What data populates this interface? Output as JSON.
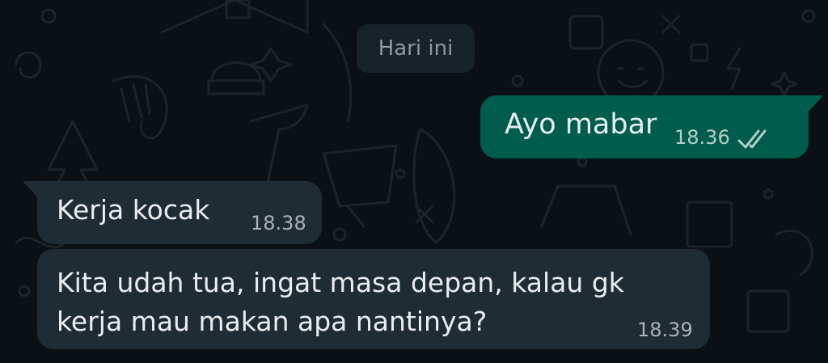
{
  "chat": {
    "date_separator": "Hari ini",
    "messages": [
      {
        "direction": "outgoing",
        "text": "Ayo mabar",
        "time": "18.36",
        "status": "read"
      },
      {
        "direction": "incoming",
        "text": "Kerja kocak",
        "time": "18.38"
      },
      {
        "direction": "incoming",
        "text": "Kita udah tua, ingat masa depan, kalau gk\nkerja mau makan apa nantinya?",
        "time": "18.39"
      }
    ]
  },
  "icons": {
    "read_receipt": "double-check-icon"
  },
  "colors": {
    "background": "#0b1014",
    "outgoing_bubble": "#005c4b",
    "incoming_bubble": "#202c33",
    "date_chip": "#182229",
    "read_tick": "#b5d0c8",
    "wallpaper_doodle": "#1c2429"
  }
}
